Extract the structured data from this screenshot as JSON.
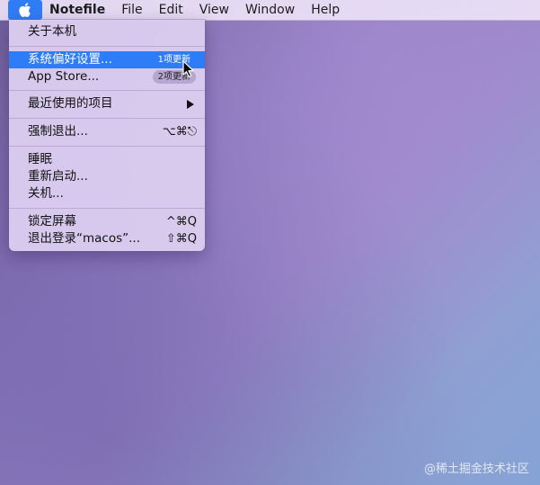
{
  "menubar": {
    "apple_icon": "apple-icon",
    "app_name": "Notefile",
    "items": [
      "File",
      "Edit",
      "View",
      "Window",
      "Help"
    ]
  },
  "apple_menu": {
    "about": "关于本机",
    "system_prefs": {
      "label": "系统偏好设置...",
      "badge": "1项更新"
    },
    "app_store": {
      "label": "App Store...",
      "badge": "2项更新"
    },
    "recent_items": "最近使用的项目",
    "force_quit": {
      "label": "强制退出...",
      "shortcut": "⌥⌘⎋"
    },
    "sleep": "睡眠",
    "restart": "重新启动...",
    "shutdown": "关机...",
    "lock_screen": {
      "label": "锁定屏幕",
      "shortcut": "^⌘Q"
    },
    "logout": {
      "label": "退出登录“macos”...",
      "shortcut": "⇧⌘Q"
    }
  },
  "watermark": "@稀土掘金技术社区",
  "colors": {
    "highlight": "#2f7df6",
    "menu_bg": "#dacce8",
    "wallpaper_start": "#6f5e9a",
    "wallpaper_end": "#86a3d6"
  }
}
